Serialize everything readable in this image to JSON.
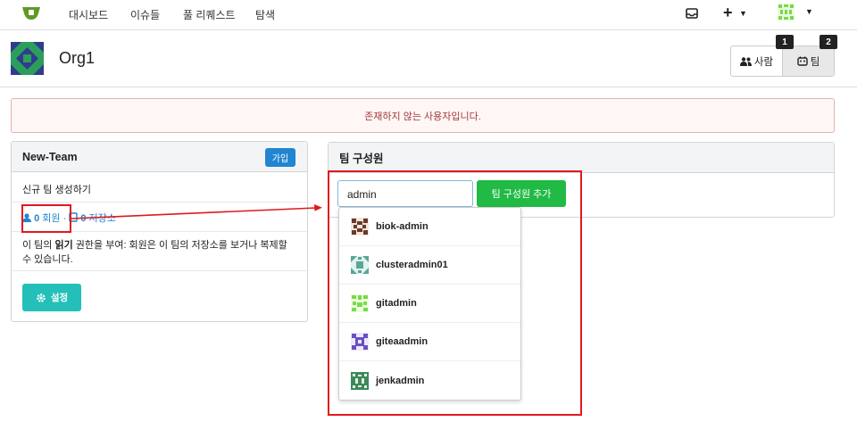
{
  "nav": {
    "items": [
      "대시보드",
      "이슈들",
      "풀 리퀘스트",
      "탐색"
    ],
    "plus_icon": "+",
    "accent": "#609926"
  },
  "org": {
    "name": "Org1",
    "tabs": [
      {
        "label": "사람",
        "icon": "people-icon",
        "badge": "1"
      },
      {
        "label": "팀",
        "icon": "team-icon",
        "badge": "2"
      }
    ]
  },
  "alert": {
    "message": "존재하지 않는 사용자입니다.",
    "color": "#9f3a38"
  },
  "team_card": {
    "name": "New-Team",
    "join_label": "가입",
    "description": "신규 팀 생성하기",
    "members_count": "0",
    "members_label": "회원",
    "separator": "·",
    "repos_count": "0",
    "repos_label": "저장소",
    "permission_prefix": "이 팀의 ",
    "permission_strong": "읽기",
    "permission_suffix": " 권한을 부여: 회원은 이 팀의 저장소를 보거나 복제할 수 있습니다.",
    "settings_label": "설정"
  },
  "members_card": {
    "title": "팀 구성원",
    "input_value": "admin",
    "add_label": "팀 구성원 추가"
  },
  "suggestions": [
    {
      "name": "biok-admin",
      "color": "#6b3a26"
    },
    {
      "name": "clusteradmin01",
      "color": "#5aa69a"
    },
    {
      "name": "gitadmin",
      "color": "#7bd94a"
    },
    {
      "name": "giteaadmin",
      "color": "#6b4fc2"
    },
    {
      "name": "jenkadmin",
      "color": "#3c8a5a"
    }
  ]
}
